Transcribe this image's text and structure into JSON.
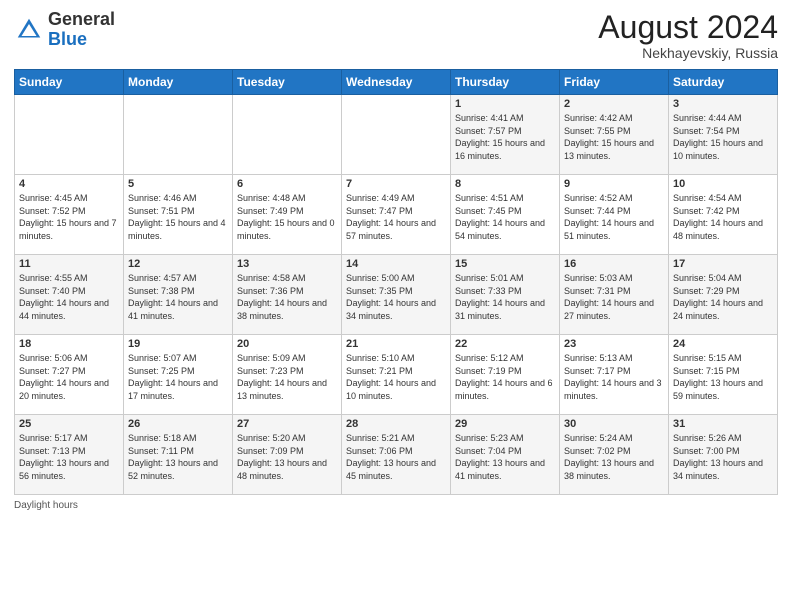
{
  "header": {
    "logo_general": "General",
    "logo_blue": "Blue",
    "month_year": "August 2024",
    "location": "Nekhayevskiy, Russia"
  },
  "weekdays": [
    "Sunday",
    "Monday",
    "Tuesday",
    "Wednesday",
    "Thursday",
    "Friday",
    "Saturday"
  ],
  "footer": {
    "daylight_hours": "Daylight hours"
  },
  "weeks": [
    [
      {
        "day": "",
        "info": ""
      },
      {
        "day": "",
        "info": ""
      },
      {
        "day": "",
        "info": ""
      },
      {
        "day": "",
        "info": ""
      },
      {
        "day": "1",
        "info": "Sunrise: 4:41 AM\nSunset: 7:57 PM\nDaylight: 15 hours and 16 minutes."
      },
      {
        "day": "2",
        "info": "Sunrise: 4:42 AM\nSunset: 7:55 PM\nDaylight: 15 hours and 13 minutes."
      },
      {
        "day": "3",
        "info": "Sunrise: 4:44 AM\nSunset: 7:54 PM\nDaylight: 15 hours and 10 minutes."
      }
    ],
    [
      {
        "day": "4",
        "info": "Sunrise: 4:45 AM\nSunset: 7:52 PM\nDaylight: 15 hours and 7 minutes."
      },
      {
        "day": "5",
        "info": "Sunrise: 4:46 AM\nSunset: 7:51 PM\nDaylight: 15 hours and 4 minutes."
      },
      {
        "day": "6",
        "info": "Sunrise: 4:48 AM\nSunset: 7:49 PM\nDaylight: 15 hours and 0 minutes."
      },
      {
        "day": "7",
        "info": "Sunrise: 4:49 AM\nSunset: 7:47 PM\nDaylight: 14 hours and 57 minutes."
      },
      {
        "day": "8",
        "info": "Sunrise: 4:51 AM\nSunset: 7:45 PM\nDaylight: 14 hours and 54 minutes."
      },
      {
        "day": "9",
        "info": "Sunrise: 4:52 AM\nSunset: 7:44 PM\nDaylight: 14 hours and 51 minutes."
      },
      {
        "day": "10",
        "info": "Sunrise: 4:54 AM\nSunset: 7:42 PM\nDaylight: 14 hours and 48 minutes."
      }
    ],
    [
      {
        "day": "11",
        "info": "Sunrise: 4:55 AM\nSunset: 7:40 PM\nDaylight: 14 hours and 44 minutes."
      },
      {
        "day": "12",
        "info": "Sunrise: 4:57 AM\nSunset: 7:38 PM\nDaylight: 14 hours and 41 minutes."
      },
      {
        "day": "13",
        "info": "Sunrise: 4:58 AM\nSunset: 7:36 PM\nDaylight: 14 hours and 38 minutes."
      },
      {
        "day": "14",
        "info": "Sunrise: 5:00 AM\nSunset: 7:35 PM\nDaylight: 14 hours and 34 minutes."
      },
      {
        "day": "15",
        "info": "Sunrise: 5:01 AM\nSunset: 7:33 PM\nDaylight: 14 hours and 31 minutes."
      },
      {
        "day": "16",
        "info": "Sunrise: 5:03 AM\nSunset: 7:31 PM\nDaylight: 14 hours and 27 minutes."
      },
      {
        "day": "17",
        "info": "Sunrise: 5:04 AM\nSunset: 7:29 PM\nDaylight: 14 hours and 24 minutes."
      }
    ],
    [
      {
        "day": "18",
        "info": "Sunrise: 5:06 AM\nSunset: 7:27 PM\nDaylight: 14 hours and 20 minutes."
      },
      {
        "day": "19",
        "info": "Sunrise: 5:07 AM\nSunset: 7:25 PM\nDaylight: 14 hours and 17 minutes."
      },
      {
        "day": "20",
        "info": "Sunrise: 5:09 AM\nSunset: 7:23 PM\nDaylight: 14 hours and 13 minutes."
      },
      {
        "day": "21",
        "info": "Sunrise: 5:10 AM\nSunset: 7:21 PM\nDaylight: 14 hours and 10 minutes."
      },
      {
        "day": "22",
        "info": "Sunrise: 5:12 AM\nSunset: 7:19 PM\nDaylight: 14 hours and 6 minutes."
      },
      {
        "day": "23",
        "info": "Sunrise: 5:13 AM\nSunset: 7:17 PM\nDaylight: 14 hours and 3 minutes."
      },
      {
        "day": "24",
        "info": "Sunrise: 5:15 AM\nSunset: 7:15 PM\nDaylight: 13 hours and 59 minutes."
      }
    ],
    [
      {
        "day": "25",
        "info": "Sunrise: 5:17 AM\nSunset: 7:13 PM\nDaylight: 13 hours and 56 minutes."
      },
      {
        "day": "26",
        "info": "Sunrise: 5:18 AM\nSunset: 7:11 PM\nDaylight: 13 hours and 52 minutes."
      },
      {
        "day": "27",
        "info": "Sunrise: 5:20 AM\nSunset: 7:09 PM\nDaylight: 13 hours and 48 minutes."
      },
      {
        "day": "28",
        "info": "Sunrise: 5:21 AM\nSunset: 7:06 PM\nDaylight: 13 hours and 45 minutes."
      },
      {
        "day": "29",
        "info": "Sunrise: 5:23 AM\nSunset: 7:04 PM\nDaylight: 13 hours and 41 minutes."
      },
      {
        "day": "30",
        "info": "Sunrise: 5:24 AM\nSunset: 7:02 PM\nDaylight: 13 hours and 38 minutes."
      },
      {
        "day": "31",
        "info": "Sunrise: 5:26 AM\nSunset: 7:00 PM\nDaylight: 13 hours and 34 minutes."
      }
    ]
  ]
}
